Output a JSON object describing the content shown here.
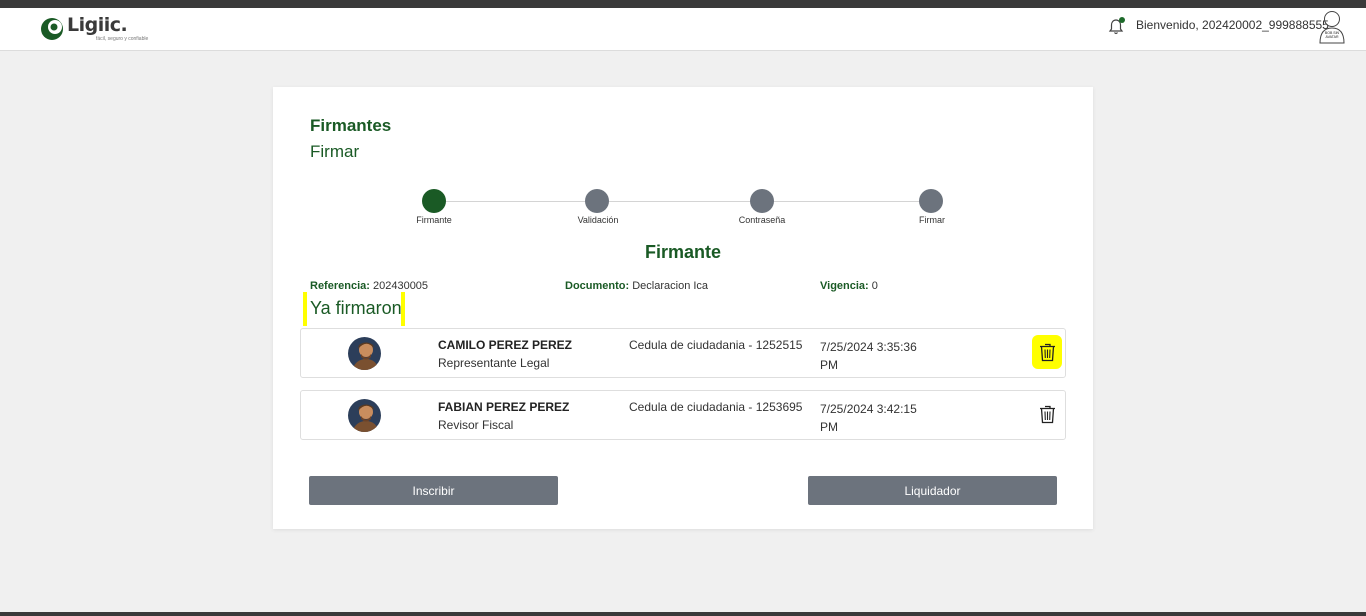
{
  "header": {
    "logo_text": "Ligiic.",
    "logo_tagline": "fácil, seguro y confiable",
    "welcome": "Bienvenido, 202420002_999888555",
    "avatar_text": "BOB SIN AVATAR",
    "notification_active": true
  },
  "card": {
    "title": "Firmantes",
    "subtitle": "Firmar"
  },
  "stepper": {
    "steps": [
      {
        "label": "Firmante",
        "active": true
      },
      {
        "label": "Validación",
        "active": false
      },
      {
        "label": "Contraseña",
        "active": false
      },
      {
        "label": "Firmar",
        "active": false
      }
    ]
  },
  "section": {
    "title": "Firmante",
    "referencia_label": "Referencia:",
    "referencia_value": "202430005",
    "documento_label": "Documento:",
    "documento_value": "Declaracion Ica",
    "vigencia_label": "Vigencia:",
    "vigencia_value": "0",
    "signed_title": "Ya firmaron"
  },
  "signers": [
    {
      "name": "CAMILO PEREZ PEREZ",
      "role": "Representante Legal",
      "document": "Cedula de ciudadania - 1252515",
      "date": "7/25/2024 3:35:36 PM",
      "delete_highlighted": true
    },
    {
      "name": "FABIAN PEREZ PEREZ",
      "role": "Revisor Fiscal",
      "document": "Cedula de ciudadania - 1253695",
      "date": "7/25/2024 3:42:15 PM",
      "delete_highlighted": false
    }
  ],
  "buttons": {
    "left": "Inscribir",
    "right": "Liquidador"
  },
  "colors": {
    "brand_green": "#1a5a25",
    "step_gray": "#6c737d",
    "highlight": "#ffff00",
    "button": "#6c737d"
  }
}
